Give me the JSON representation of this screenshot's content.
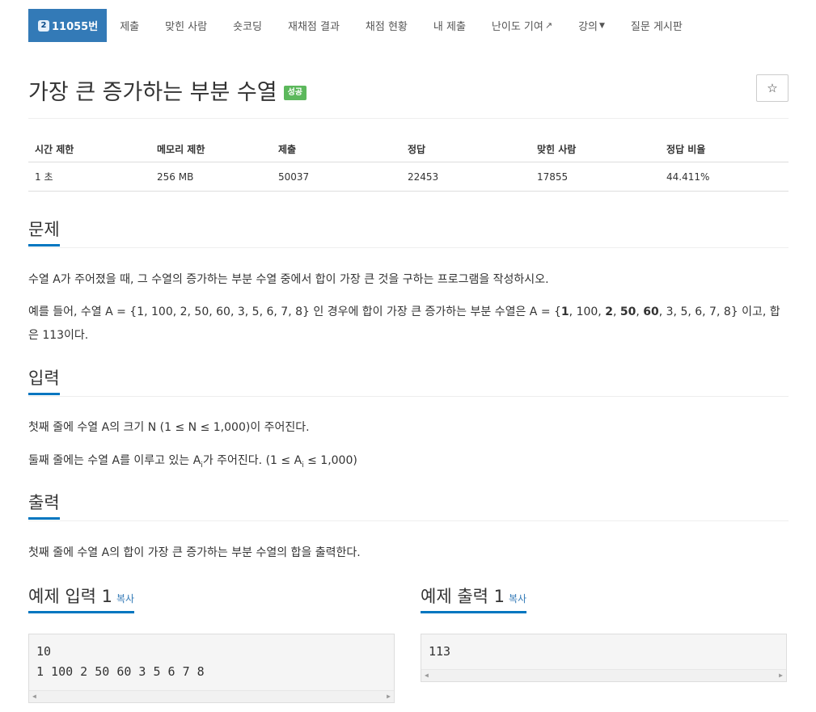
{
  "nav": {
    "problem_number": "11055번",
    "tier_icon": "2",
    "items": [
      "제출",
      "맞힌 사람",
      "숏코딩",
      "재채점 결과",
      "채점 현황",
      "내 제출",
      "난이도 기여",
      "강의",
      "질문 게시판"
    ],
    "external_icon": "external-link-icon",
    "caret_icon": "caret-down-icon"
  },
  "problem": {
    "title": "가장 큰 증가하는 부분 수열",
    "status_badge": "성공",
    "star_icon": "☆"
  },
  "info_table": {
    "headers": [
      "시간 제한",
      "메모리 제한",
      "제출",
      "정답",
      "맞힌 사람",
      "정답 비율"
    ],
    "values": [
      "1 초",
      "256 MB",
      "50037",
      "22453",
      "17855",
      "44.411%"
    ]
  },
  "sections": {
    "description_title": "문제",
    "description_p1": "수열 A가 주어졌을 때, 그 수열의 증가하는 부분 수열 중에서 합이 가장 큰 것을 구하는 프로그램을 작성하시오.",
    "description_p2_before": "예를 들어, 수열 A = {1, 100, 2, 50, 60, 3, 5, 6, 7, 8} 인 경우에 합이 가장 큰 증가하는 부분 수열은 A = {",
    "description_p2_b1": "1",
    "description_p2_s1": ", 100, ",
    "description_p2_b2": "2",
    "description_p2_s2": ", ",
    "description_p2_b3": "50",
    "description_p2_s3": ", ",
    "description_p2_b4": "60",
    "description_p2_after": ", 3, 5, 6, 7, 8} 이고, 합은 113이다.",
    "input_title": "입력",
    "input_p1": "첫째 줄에 수열 A의 크기 N (1 ≤ N ≤ 1,000)이 주어진다.",
    "input_p2_a": "둘째 줄에는 수열 A를 이루고 있는 A",
    "input_p2_sub1": "i",
    "input_p2_b": "가 주어진다. (1 ≤ A",
    "input_p2_sub2": "i",
    "input_p2_c": " ≤ 1,000)",
    "output_title": "출력",
    "output_p1": "첫째 줄에 수열 A의 합이 가장 큰 증가하는 부분 수열의 합을 출력한다."
  },
  "samples": {
    "input_title": "예제 입력 1",
    "output_title": "예제 출력 1",
    "copy_label": "복사",
    "input_text": "10\n1 100 2 50 60 3 5 6 7 8",
    "output_text": "113"
  },
  "colors": {
    "nav_active": "#337ab7",
    "badge_success": "#5cb85c",
    "section_underline": "#0076c0",
    "link": "#337ab7"
  }
}
